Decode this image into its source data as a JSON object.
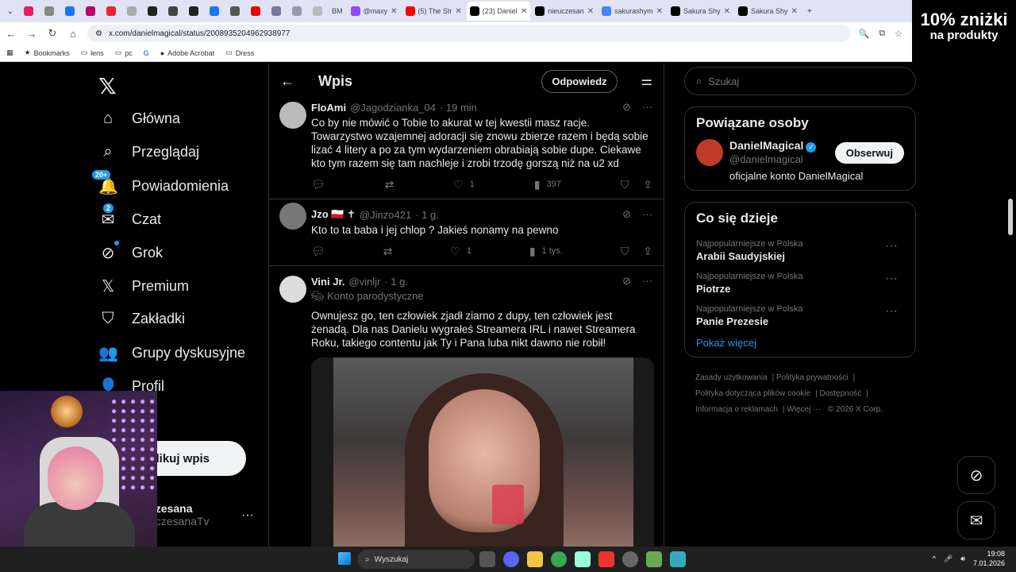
{
  "browser": {
    "tabs": [
      {
        "label": "@maxy",
        "color": "#9146ff"
      },
      {
        "label": "(5) The Str",
        "color": "#ff0000"
      },
      {
        "label": "(23) Daniel",
        "color": "#000000",
        "active": true
      },
      {
        "label": "nieuczesan",
        "color": "#000000"
      },
      {
        "label": "sakurashym",
        "color": "#4285f4"
      },
      {
        "label": "Sakura Shy",
        "color": "#000000"
      },
      {
        "label": "Sakura Shy",
        "color": "#000000"
      }
    ],
    "small_tab_labels": [
      "BM"
    ],
    "url": "x.com/danielmagical/status/2008935204962938977",
    "bookmarks": [
      "Bookmarks",
      "lens",
      "pc",
      "Adobe Acrobat",
      "Dress"
    ],
    "promo": {
      "line1": "10% zniżki",
      "line2": "na produkty"
    }
  },
  "nav": {
    "items": [
      {
        "label": "Główna",
        "icon": "home-icon"
      },
      {
        "label": "Przeglądaj",
        "icon": "search-icon"
      },
      {
        "label": "Powiadomienia",
        "icon": "bell-icon",
        "badge": "20+"
      },
      {
        "label": "Czat",
        "icon": "mail-icon",
        "badge": "2"
      },
      {
        "label": "Grok",
        "icon": "grok-icon"
      },
      {
        "label": "Premium",
        "icon": "x-icon"
      },
      {
        "label": "Zakładki",
        "icon": "bookmark-icon"
      },
      {
        "label": "Grupy dyskusyjne",
        "icon": "people-icon"
      },
      {
        "label": "Profil",
        "icon": "person-icon"
      },
      {
        "label": "iej",
        "icon": "more-icon"
      }
    ],
    "post_button": "likuj wpis",
    "profile_name": "czesana",
    "profile_handle": "uczesanaTv"
  },
  "main": {
    "title": "Wpis",
    "reply_button": "Odpowiedz",
    "posts": [
      {
        "name": "FloAmi",
        "handle": "@Jagodzianka_04",
        "time": "· 19 min",
        "text": "Co by nie mówić o Tobie to akurat w tej kwestii masz racje. Towarzystwo wzajemnej adoracji się znowu zbierze razem i będą sobie lizać 4 litery a po za tym wydarzeniem obrabiają sobie dupe. Ciekawe kto tym razem się tam nachleje i zrobi trzodę gorszą niż na u2 xd",
        "likes": "1",
        "views": "397"
      },
      {
        "name": "Jzo 🇵🇱 ✝",
        "handle": "@Jinzo421",
        "time": "· 1 g.",
        "text": "Kto to ta baba i jej chlop ? Jakieś nonamy na pewno",
        "likes": "1",
        "views": "1 tys."
      },
      {
        "name": "Vini Jr.",
        "handle": "@vinljr",
        "time": "· 1 g.",
        "parody": "Konto parodystyczne",
        "text": "Ownujesz go, ten człowiek zjadł ziarno z dupy, ten człowiek jest żenadą. Dla nas Danielu wygrałeś Streamera IRL i nawet Streamera Roku, takiego contentu jak Ty i Pana luba nikt dawno nie robił!"
      }
    ]
  },
  "right": {
    "search_placeholder": "Szukaj",
    "related_title": "Powiązane osoby",
    "person": {
      "name": "DanielMagical",
      "handle": "@danielmagical",
      "bio": "oficjalne konto DanielMagical",
      "follow": "Obserwuj"
    },
    "trends_title": "Co się dzieje",
    "trends": [
      {
        "context": "Najpopularniejsze w Polska",
        "title": "Arabii Saudyjskiej"
      },
      {
        "context": "Najpopularniejsze w Polska",
        "title": "Piotrze"
      },
      {
        "context": "Najpopularniejsze w Polska",
        "title": "Panie Prezesie"
      }
    ],
    "show_more": "Pokaż więcej",
    "footer": [
      "Zasady użytkowania",
      "Polityka prywatności",
      "Polityka dotycząca plików cookie",
      "Dostępność",
      "Informacja o reklamach",
      "Więcej ···",
      "© 2026 X Corp."
    ]
  },
  "taskbar": {
    "search": "Wyszukaj",
    "time": "19:08",
    "date": "7.01.2026"
  }
}
